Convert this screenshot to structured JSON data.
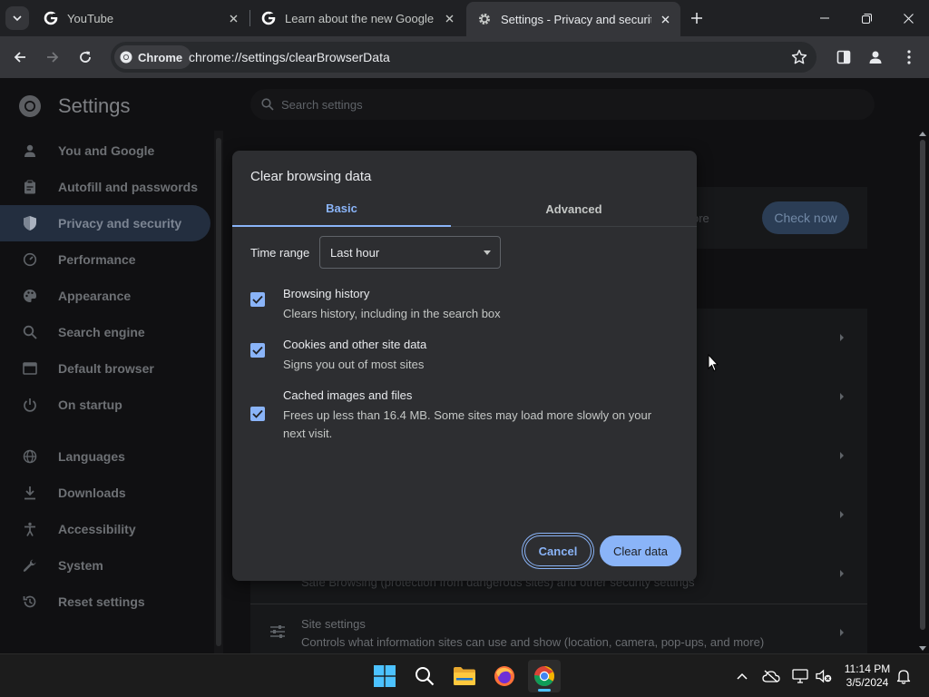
{
  "browser": {
    "tabs": [
      {
        "title": "YouTube",
        "active": false
      },
      {
        "title": "Learn about the new Google sign-in",
        "active": false
      },
      {
        "title": "Settings - Privacy and security",
        "active": true
      }
    ],
    "chip_label": "Chrome",
    "url": "chrome://settings/clearBrowserData"
  },
  "settings": {
    "title": "Settings",
    "search_placeholder": "Search settings",
    "nav": [
      {
        "label": "You and Google",
        "icon": "person-icon"
      },
      {
        "label": "Autofill and passwords",
        "icon": "clipboard-icon"
      },
      {
        "label": "Privacy and security",
        "icon": "shield-icon",
        "active": true
      },
      {
        "label": "Performance",
        "icon": "gauge-icon"
      },
      {
        "label": "Appearance",
        "icon": "palette-icon"
      },
      {
        "label": "Search engine",
        "icon": "search-icon"
      },
      {
        "label": "Default browser",
        "icon": "browser-icon"
      },
      {
        "label": "On startup",
        "icon": "power-icon"
      },
      {
        "label": "Languages",
        "icon": "globe-icon"
      },
      {
        "label": "Downloads",
        "icon": "download-icon"
      },
      {
        "label": "Accessibility",
        "icon": "accessibility-icon"
      },
      {
        "label": "System",
        "icon": "wrench-icon"
      },
      {
        "label": "Reset settings",
        "icon": "reset-icon"
      }
    ],
    "safety_check_button": "Check now",
    "safety_check_partial": "ore",
    "bg_rows": [
      {
        "desc": "Safe Browsing (protection from dangerous sites) and other security settings"
      },
      {
        "title": "Site settings",
        "desc": "Controls what information sites can use and show (location, camera, pop-ups, and more)"
      }
    ]
  },
  "dialog": {
    "title": "Clear browsing data",
    "tabs": [
      {
        "label": "Basic",
        "active": true
      },
      {
        "label": "Advanced",
        "active": false
      }
    ],
    "time_range_label": "Time range",
    "time_range_value": "Last hour",
    "options": [
      {
        "title": "Browsing history",
        "desc": "Clears history, including in the search box",
        "checked": true
      },
      {
        "title": "Cookies and other site data",
        "desc": "Signs you out of most sites",
        "checked": true
      },
      {
        "title": "Cached images and files",
        "desc": "Frees up less than 16.4 MB. Some sites may load more slowly on your next visit.",
        "checked": true
      }
    ],
    "cancel_label": "Cancel",
    "confirm_label": "Clear data"
  },
  "taskbar": {
    "time": "11:14 PM",
    "date": "3/5/2024"
  },
  "colors": {
    "accent": "#8ab4f8",
    "dialog_bg": "#2d2e31",
    "toolbar_bg": "#35363a",
    "taskbar_indicator": "#4cc2ff"
  }
}
